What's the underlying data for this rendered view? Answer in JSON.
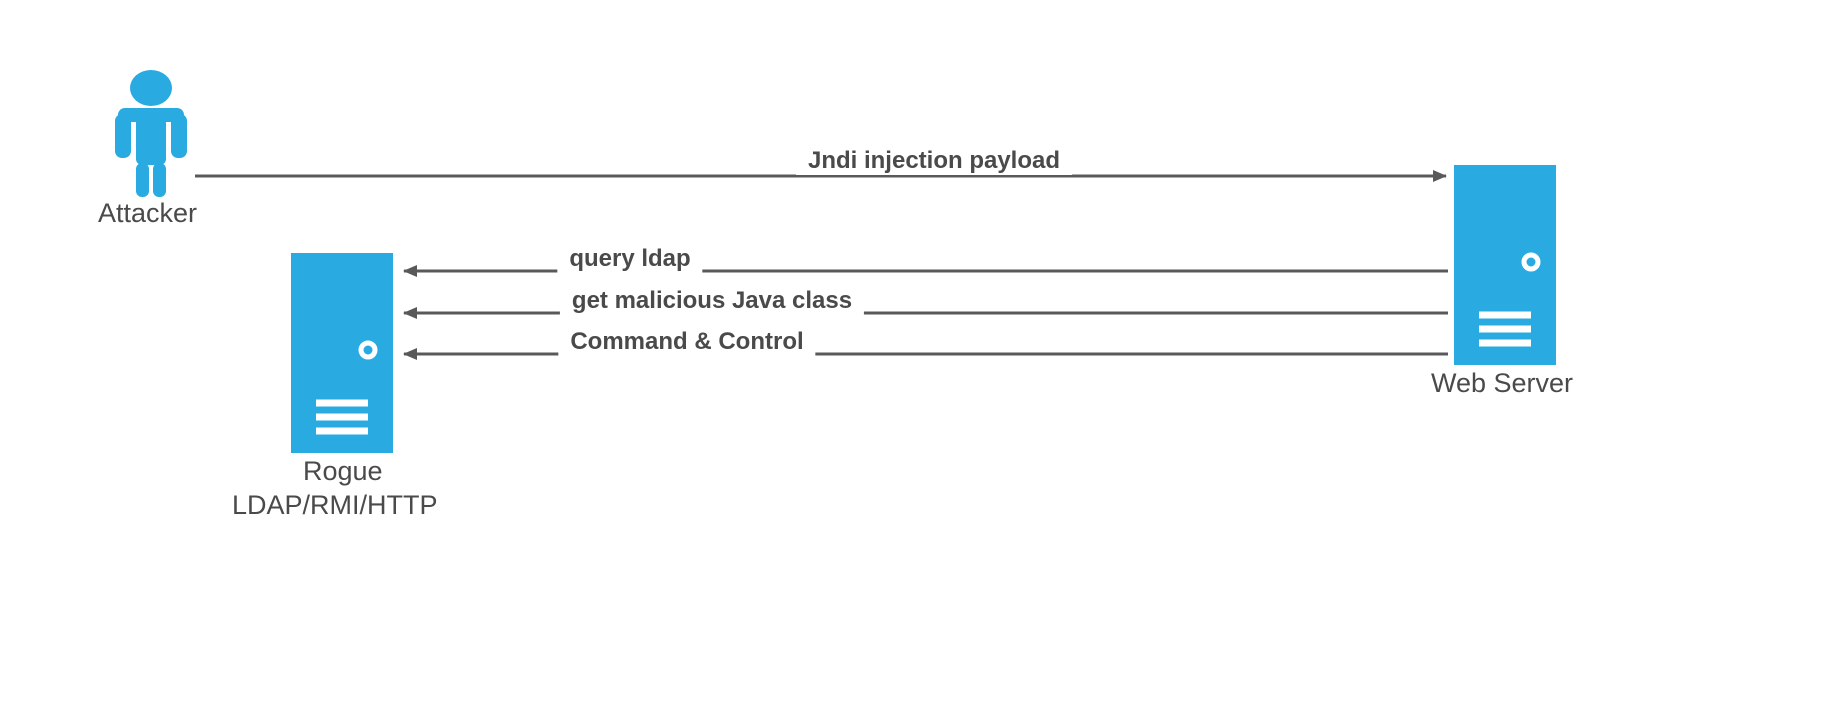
{
  "colors": {
    "accent": "#29abe2",
    "line": "#595959",
    "text": "#4a4a4a"
  },
  "nodes": {
    "attacker": {
      "label": "Attacker"
    },
    "rogue": {
      "label_line1": "Rogue",
      "label_line2": "LDAP/RMI/HTTP"
    },
    "webserver": {
      "label": "Web Server"
    }
  },
  "arrows": {
    "a1": {
      "label": "Jndi injection payload"
    },
    "a2": {
      "label": "query ldap"
    },
    "a3": {
      "label": "get malicious Java class"
    },
    "a4": {
      "label": "Command & Control"
    }
  }
}
